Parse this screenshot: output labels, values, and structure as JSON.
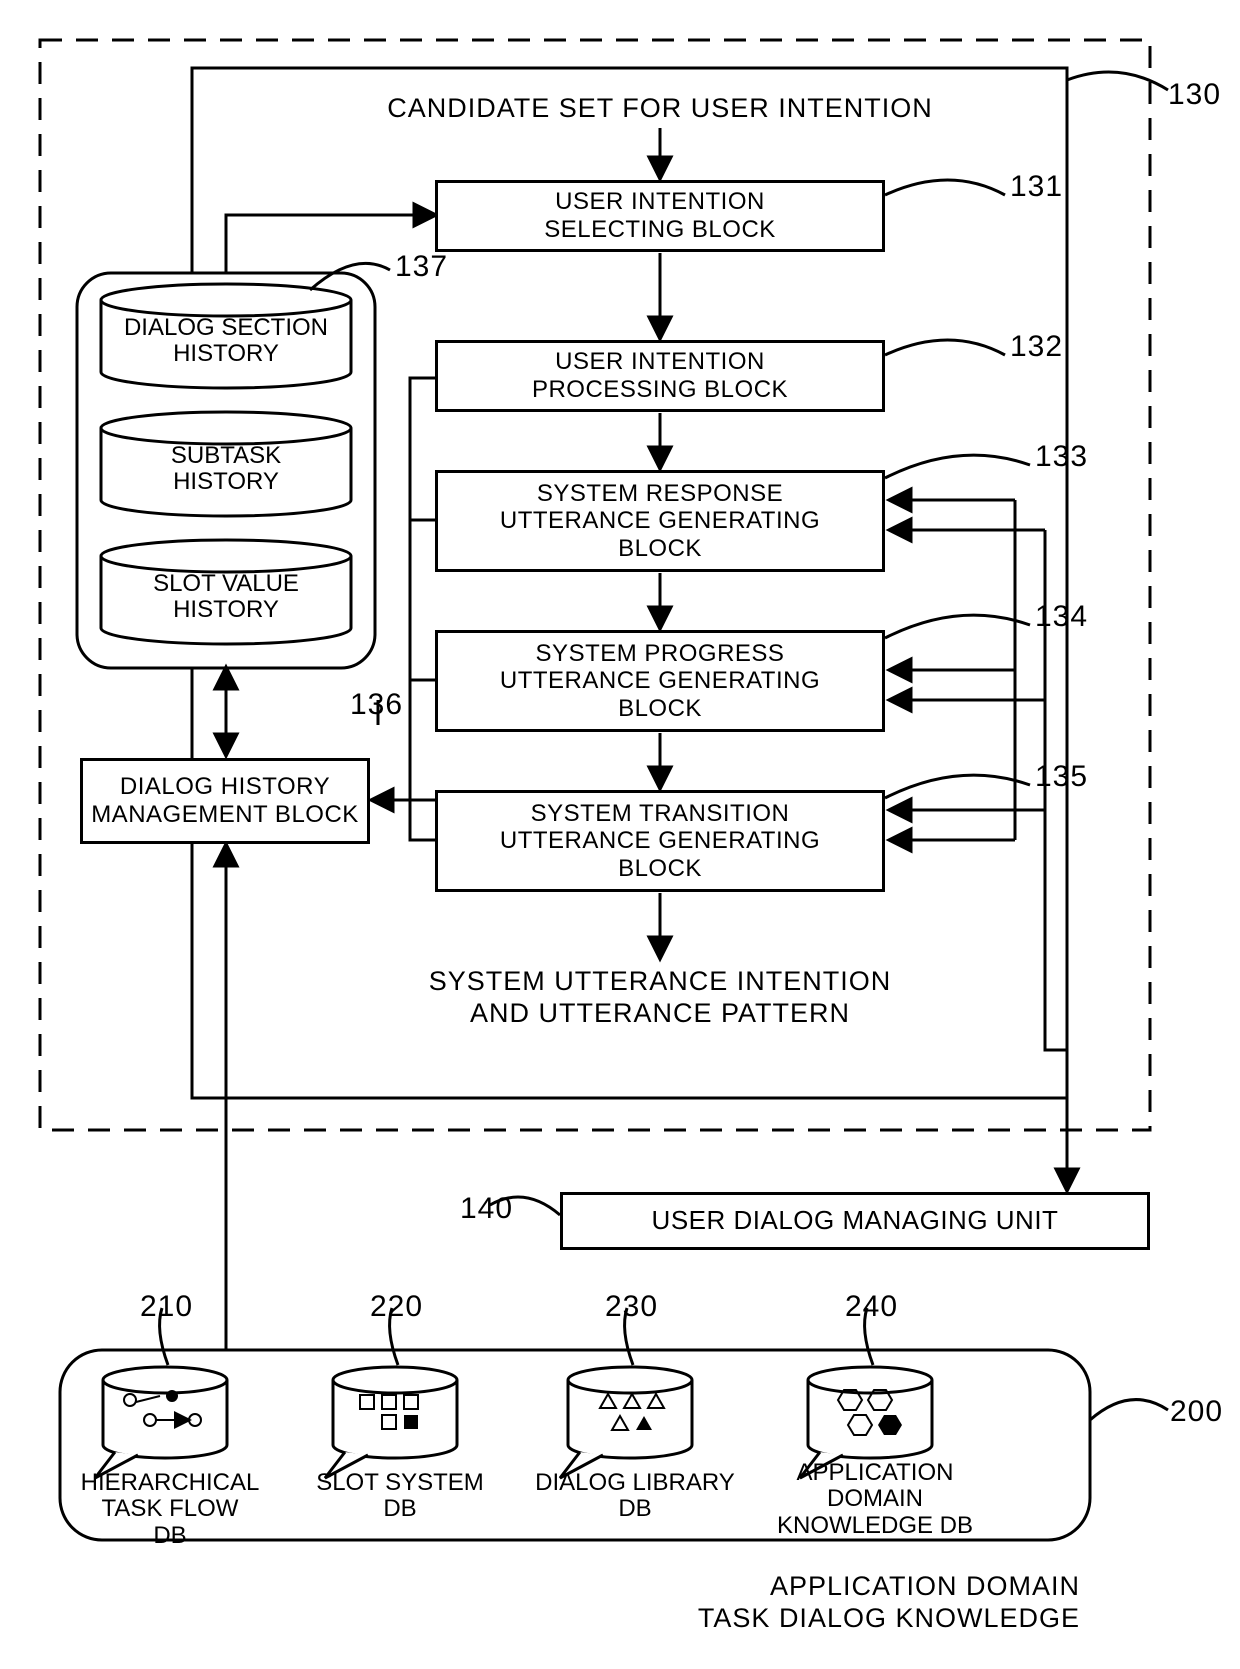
{
  "refs": {
    "r130": "130",
    "r131": "131",
    "r132": "132",
    "r133": "133",
    "r134": "134",
    "r135": "135",
    "r136": "136",
    "r137": "137",
    "r140": "140",
    "r200": "200",
    "r210": "210",
    "r220": "220",
    "r230": "230",
    "r240": "240"
  },
  "text": {
    "candidate_set": "CANDIDATE SET FOR USER INTENTION",
    "user_intention_selecting": "USER INTENTION\nSELECTING BLOCK",
    "user_intention_processing": "USER INTENTION\nPROCESSING BLOCK",
    "system_response": "SYSTEM RESPONSE\nUTTERANCE GENERATING\nBLOCK",
    "system_progress": "SYSTEM PROGRESS\nUTTERANCE GENERATING\nBLOCK",
    "system_transition": "SYSTEM TRANSITION\nUTTERANCE GENERATING\nBLOCK",
    "dialog_section_history": "DIALOG SECTION\nHISTORY",
    "subtask_history": "SUBTASK\nHISTORY",
    "slot_value_history": "SLOT VALUE\nHISTORY",
    "dialog_history_mgmt": "DIALOG HISTORY\nMANAGEMENT BLOCK",
    "system_utterance_out": "SYSTEM UTTERANCE INTENTION\nAND UTTERANCE PATTERN",
    "user_dialog_managing": "USER DIALOG MANAGING UNIT",
    "hierarchical_task_flow_db": "HIERARCHICAL\nTASK FLOW\nDB",
    "slot_system_db": "SLOT SYSTEM\nDB",
    "dialog_library_db": "DIALOG LIBRARY\nDB",
    "application_domain_knowledge_db": "APPLICATION\nDOMAIN\nKNOWLEDGE DB",
    "app_domain_footer": "APPLICATION DOMAIN\nTASK DIALOG KNOWLEDGE"
  }
}
